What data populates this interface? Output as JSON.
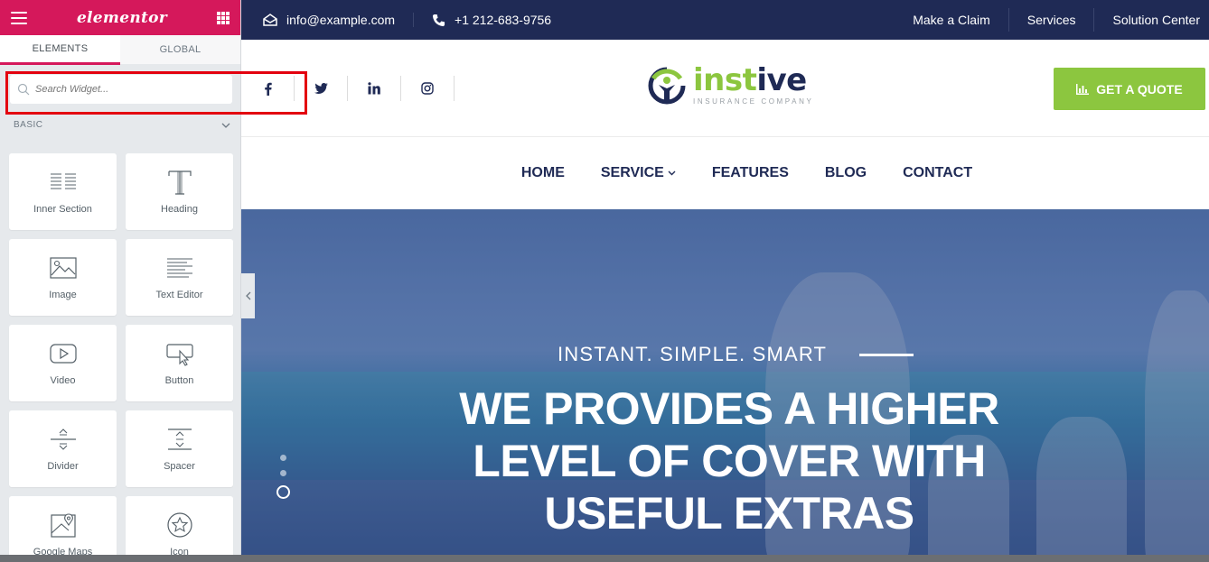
{
  "elementor": {
    "brand": "elementor",
    "tabs": {
      "elements": "ELEMENTS",
      "global": "GLOBAL"
    },
    "search": {
      "placeholder": "Search Widget..."
    },
    "category": "BASIC",
    "widgets": [
      {
        "label": "Inner Section",
        "icon": "inner-section-icon"
      },
      {
        "label": "Heading",
        "icon": "heading-icon"
      },
      {
        "label": "Image",
        "icon": "image-icon"
      },
      {
        "label": "Text Editor",
        "icon": "text-editor-icon"
      },
      {
        "label": "Video",
        "icon": "video-icon"
      },
      {
        "label": "Button",
        "icon": "button-icon"
      },
      {
        "label": "Divider",
        "icon": "divider-icon"
      },
      {
        "label": "Spacer",
        "icon": "spacer-icon"
      },
      {
        "label": "Google Maps",
        "icon": "google-maps-icon"
      },
      {
        "label": "Icon",
        "icon": "star-icon"
      }
    ],
    "accent_color": "#d5185b"
  },
  "site": {
    "topbar": {
      "email": "info@example.com",
      "phone": "+1 212-683-9756",
      "links": [
        "Make a Claim",
        "Services",
        "Solution Center"
      ]
    },
    "socials": [
      "facebook-icon",
      "twitter-icon",
      "linkedin-icon",
      "instagram-icon"
    ],
    "logo": {
      "word_a": "inst",
      "word_b": "ive",
      "subtitle": "INSURANCE COMPANY"
    },
    "quote_button": "GET A QUOTE",
    "nav": [
      "HOME",
      "SERVICE",
      "FEATURES",
      "BLOG",
      "CONTACT"
    ],
    "hero": {
      "eyebrow": "INSTANT. SIMPLE. SMART",
      "headline": "WE PROVIDES A HIGHER LEVEL OF COVER WITH USEFUL EXTRAS"
    },
    "colors": {
      "navy": "#1f2a55",
      "green": "#8cc63f"
    }
  }
}
